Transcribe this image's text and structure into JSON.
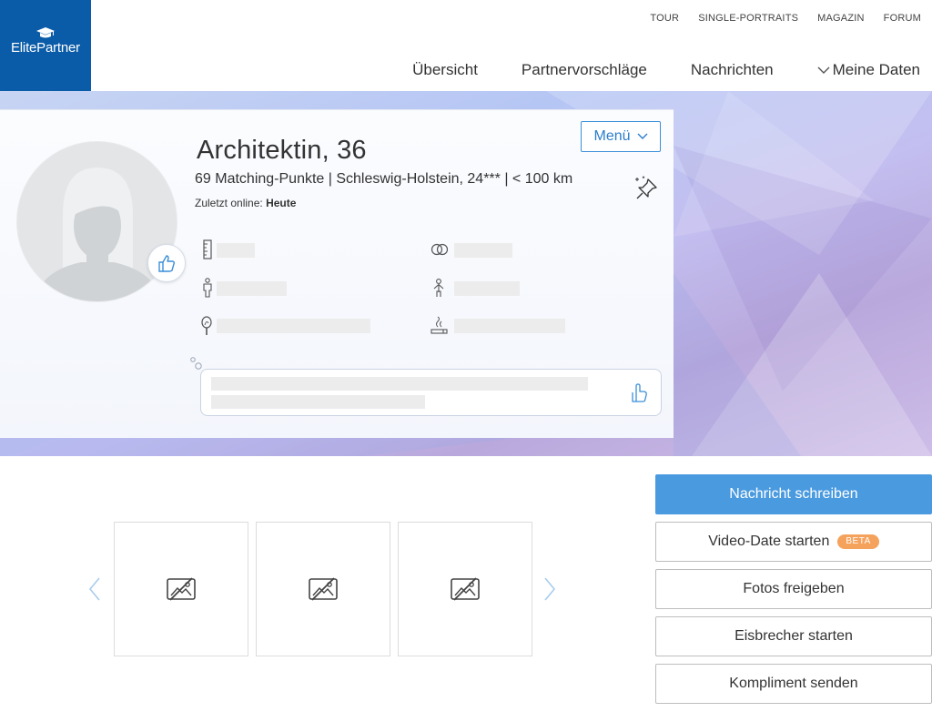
{
  "brand": {
    "name": "ElitePartner",
    "color": "#0b5ca8"
  },
  "topnav": [
    "TOUR",
    "SINGLE-PORTRAITS",
    "MAGAZIN",
    "FORUM"
  ],
  "mainnav": {
    "overview": "Übersicht",
    "suggestions": "Partnervorschläge",
    "messages": "Nachrichten",
    "my_data": "Meine Daten"
  },
  "profile": {
    "title": "Architektin, 36",
    "subline": "69 Matching-Punkte | Schleswig-Holstein, 24*** | < 100 km",
    "online_label": "Zuletzt online:",
    "online_value": "Heute",
    "menu_label": "Menü",
    "attributes": [
      {
        "icon": "height-ruler-icon"
      },
      {
        "icon": "rings-icon"
      },
      {
        "icon": "body-figure-icon"
      },
      {
        "icon": "child-figure-icon"
      },
      {
        "icon": "hand-mirror-icon"
      },
      {
        "icon": "smoking-icon"
      }
    ]
  },
  "photos": {
    "count": 3,
    "icon": "no-photo-icon"
  },
  "actions": {
    "write_message": "Nachricht schreiben",
    "video_date": "Video-Date starten",
    "video_badge": "BETA",
    "share_photos": "Fotos freigeben",
    "icebreaker": "Eisbrecher starten",
    "compliment": "Kompliment senden"
  },
  "colors": {
    "accent": "#4a9ae0",
    "link": "#2b7dcc",
    "badge": "#f5a25d"
  }
}
